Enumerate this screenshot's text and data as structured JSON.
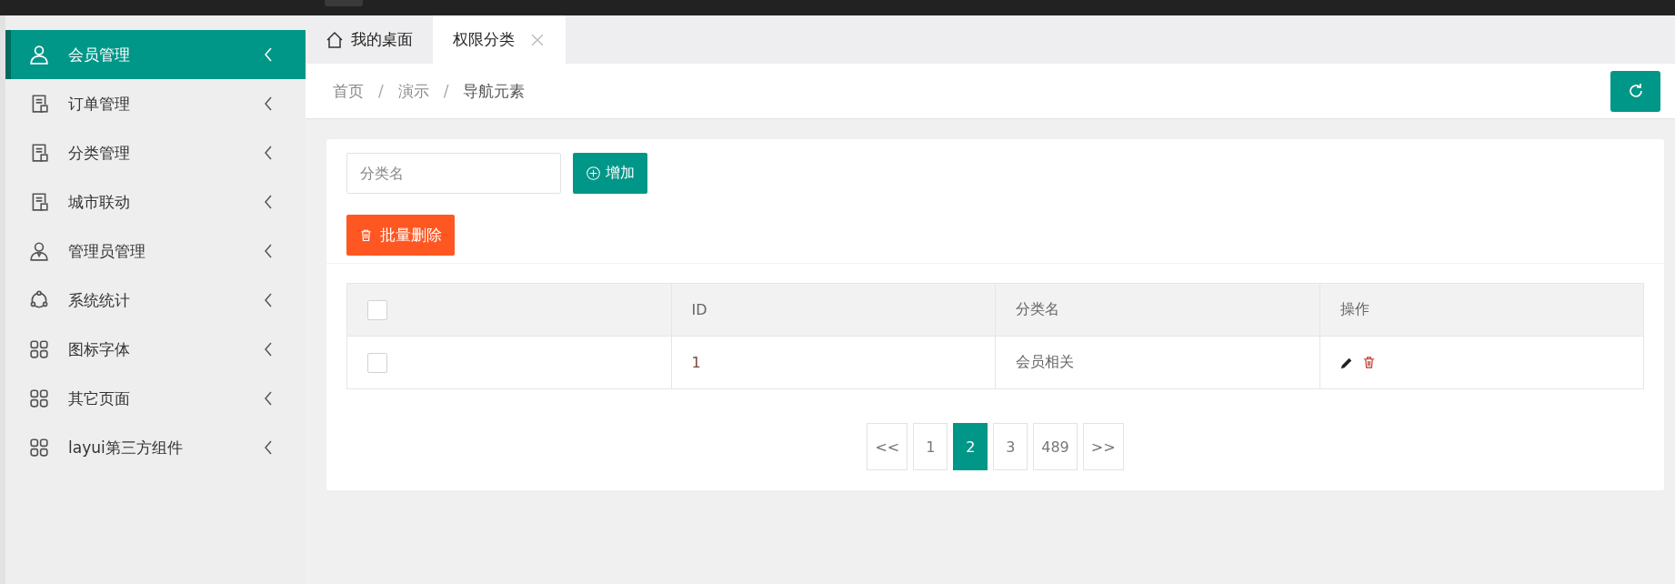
{
  "sidebar": {
    "items": [
      {
        "label": "会员管理",
        "kind": "user",
        "selected": true
      },
      {
        "label": "订单管理",
        "kind": "document",
        "selected": false
      },
      {
        "label": "分类管理",
        "kind": "document",
        "selected": false
      },
      {
        "label": "城市联动",
        "kind": "document",
        "selected": false
      },
      {
        "label": "管理员管理",
        "kind": "admin",
        "selected": false
      },
      {
        "label": "系统统计",
        "kind": "nodes",
        "selected": false
      },
      {
        "label": "图标字体",
        "kind": "grid",
        "selected": false
      },
      {
        "label": "其它页面",
        "kind": "grid",
        "selected": false
      },
      {
        "label": "layui第三方组件",
        "kind": "grid",
        "selected": false
      }
    ]
  },
  "tabs": [
    {
      "label": "我的桌面",
      "kind": "home",
      "selected": false
    },
    {
      "label": "权限分类",
      "kind": "closable",
      "selected": true
    }
  ],
  "breadcrumb": [
    {
      "label": "首页",
      "separator": "/"
    },
    {
      "label": "演示",
      "separator": "/"
    },
    {
      "label": "导航元素"
    }
  ],
  "search": {
    "placeholder": "分类名"
  },
  "add_button": "增加",
  "bulk_delete_button": "批量删除",
  "table": {
    "columns": [
      "",
      "ID",
      "分类名",
      "操作"
    ],
    "rows": [
      {
        "checked": false,
        "id": "1",
        "name": "会员相关"
      }
    ],
    "header_checked": false
  },
  "pagination": [
    {
      "label": "<<",
      "selected": false
    },
    {
      "label": "1",
      "selected": false
    },
    {
      "label": "2",
      "selected": true
    },
    {
      "label": "3",
      "selected": false
    },
    {
      "label": "489",
      "selected": false
    },
    {
      "label": ">>",
      "selected": false
    }
  ]
}
